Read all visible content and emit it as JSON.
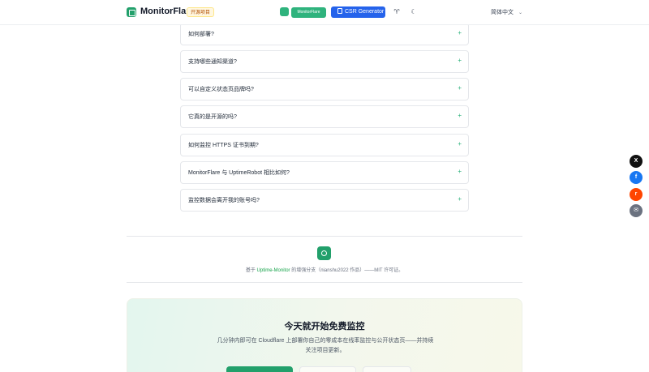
{
  "header": {
    "brand": "MonitorFlare",
    "badge": "开源项目",
    "center_pill": "MonitorFlare",
    "csr_button": "CSR Generator",
    "language": "简体中文",
    "icons": [
      "logo-icon",
      "github-icon",
      "dark-mode-icon",
      "chevron-down-icon"
    ]
  },
  "faq": {
    "items": [
      {
        "question": "如何部署?",
        "toggle": "+"
      },
      {
        "question": "支持哪些通知渠道?",
        "toggle": "+"
      },
      {
        "question": "可以自定义状态页品牌吗?",
        "toggle": "+"
      },
      {
        "question": "它真的是开源的吗?",
        "toggle": "+"
      },
      {
        "question": "如何监控 HTTPS 证书到期?",
        "toggle": "+"
      },
      {
        "question": "MonitorFlare 与 UptimeRobot 相比如何?",
        "toggle": "+"
      },
      {
        "question": "监控数据会离开我的账号吗?",
        "toggle": "+"
      }
    ]
  },
  "footer": {
    "credit_prefix": "基于",
    "credit_link": "Uptime-Monitor",
    "credit_suffix": "的增强分支（nianshu2022 作品）——MIT 许可证。"
  },
  "cta": {
    "title": "今天就开始免费监控",
    "description": "几分钟内即可在 Cloudflare 上部署你自己的零成本在线率监控与公开状态页——并持续关注项目更新。"
  },
  "share": {
    "x_label": "X",
    "facebook_label": "f",
    "reddit_label": "r",
    "email_label": "✉",
    "colors": {
      "x": "#111111",
      "facebook": "#1877f2",
      "reddit": "#ff4500",
      "email": "#6b7280"
    }
  },
  "colors": {
    "accent": "#2fb37d",
    "primary_blue": "#2563eb"
  }
}
